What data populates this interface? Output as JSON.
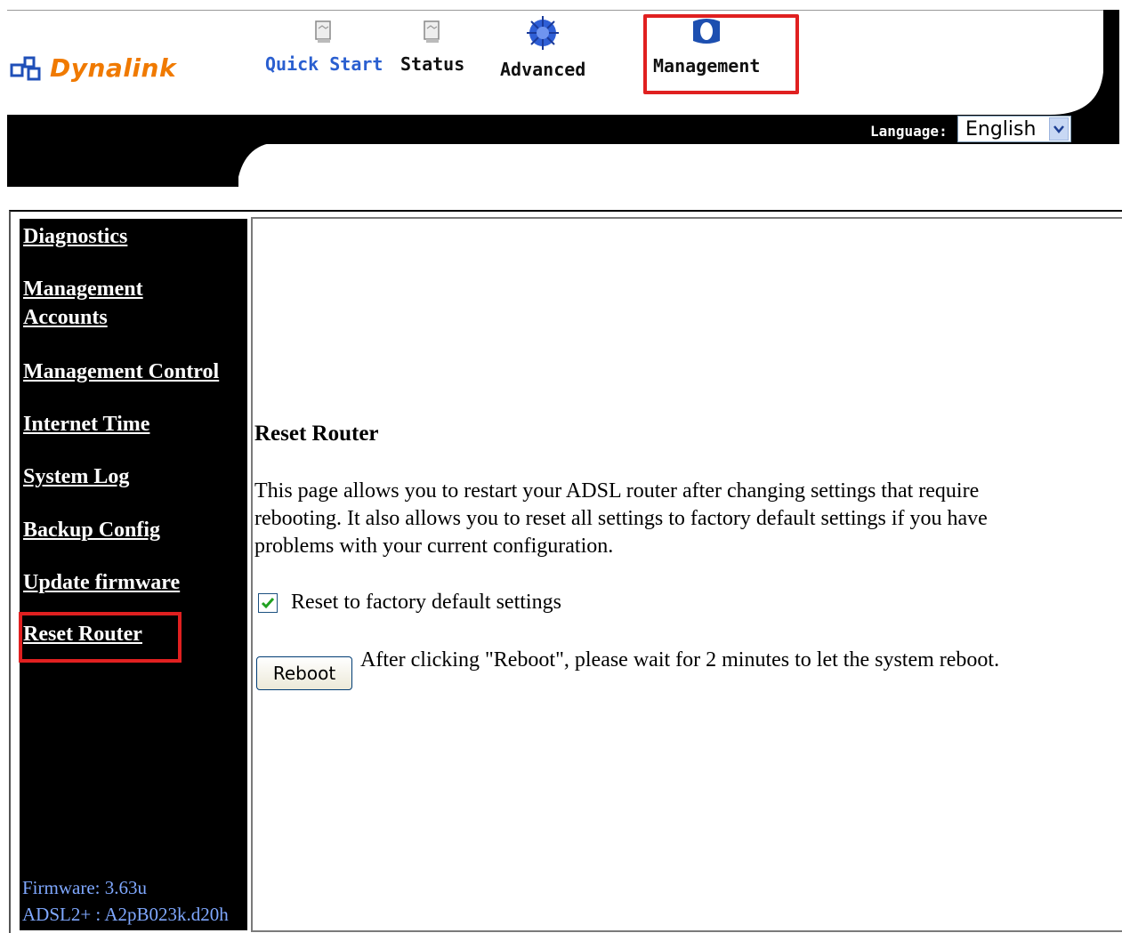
{
  "brand": {
    "name": "Dynalink",
    "color": "#f07a00"
  },
  "nav": {
    "items": [
      {
        "label": "Quick Start",
        "icon": "page-icon"
      },
      {
        "label": "Status",
        "icon": "page-icon"
      },
      {
        "label": "Advanced",
        "icon": "chip-globe-icon"
      },
      {
        "label": "Management",
        "icon": "shield-icon",
        "highlighted": true
      }
    ]
  },
  "language": {
    "label": "Language:",
    "selected": "English"
  },
  "sidebar": {
    "items": [
      {
        "label": "Diagnostics"
      },
      {
        "label": "Management Accounts"
      },
      {
        "label": "Management Control"
      },
      {
        "label": "Internet Time"
      },
      {
        "label": "System Log"
      },
      {
        "label": "Backup Config"
      },
      {
        "label": "Update firmware"
      },
      {
        "label": "Reset Router",
        "highlighted": true
      }
    ],
    "firmware": "Firmware:  3.63u",
    "adsl": "ADSL2+ :  A2pB023k.d20h"
  },
  "content": {
    "title": "Reset Router",
    "description": "This page allows you to restart your ADSL router after changing settings that require rebooting. It also allows you to reset all settings to factory default settings if you have problems with your current configuration.",
    "checkbox_label": "Reset to factory default settings",
    "checkbox_checked": true,
    "reboot_button": "Reboot",
    "reboot_note": "After clicking \"Reboot\", please wait for 2 minutes to let the system reboot."
  },
  "colors": {
    "highlight": "#e02020",
    "sidebar_bg": "#000000",
    "nav_active": "#2a5fd0"
  }
}
